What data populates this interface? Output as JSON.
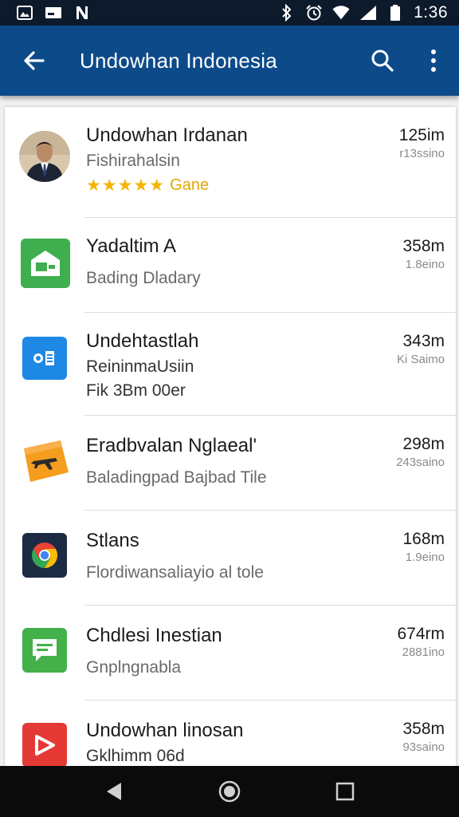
{
  "status_bar": {
    "time": "1:36",
    "icons": [
      "photo-icon",
      "cast-icon",
      "n-icon",
      "bluetooth-icon",
      "alarm-icon",
      "wifi-icon",
      "signal-icon",
      "battery-icon"
    ]
  },
  "app_bar": {
    "title": "Undowhan Indonesia",
    "back_icon": "arrow-back-icon",
    "search_icon": "search-icon",
    "menu_icon": "more-vert-icon"
  },
  "items": [
    {
      "title": "Undowhan Irdanan",
      "subtitle": "Fishirahalsin",
      "rating_stars": 5,
      "rating_label": "Gane",
      "distance": "125im",
      "meta": "r13ssino",
      "icon": "profile-photo"
    },
    {
      "title": "Yadaltim A",
      "subtitle": "Bading Dladary",
      "distance": "358m",
      "meta": "1.8eino",
      "icon": "home-card-icon",
      "accent": "#2ea043"
    },
    {
      "title": "Undehtastlah",
      "subtitle": "ReininmaUsiin",
      "subtitle2": "Fik 3Bm 00er",
      "distance": "343m",
      "meta": "Ki Saimo",
      "icon": "id-card-icon"
    },
    {
      "title": "Eradbvalan Nglaeal'",
      "subtitle": "Baladingpad Bajbad Tile",
      "distance": "298m",
      "meta": "243saino",
      "icon": "airplane-ticket-icon"
    },
    {
      "title": "Stlans",
      "subtitle": "Flordiwansaliayio al tole",
      "distance": "168m",
      "meta": "1.9eino",
      "icon": "chrome-icon"
    },
    {
      "title": "Chdlesi Inestian",
      "subtitle": "Gnplngnabla",
      "distance": "674rm",
      "meta": "2881ino",
      "icon": "message-icon"
    },
    {
      "title": "Undowhan linosan",
      "subtitle": "Gklhimm 06d",
      "distance": "358m",
      "meta": "93saino",
      "icon": "play-icon"
    }
  ],
  "colors": {
    "app_bar": "#0d4a8a",
    "status_bar": "#0d1a2b",
    "accent_green": "#2ea043",
    "star": "#f4b400"
  }
}
